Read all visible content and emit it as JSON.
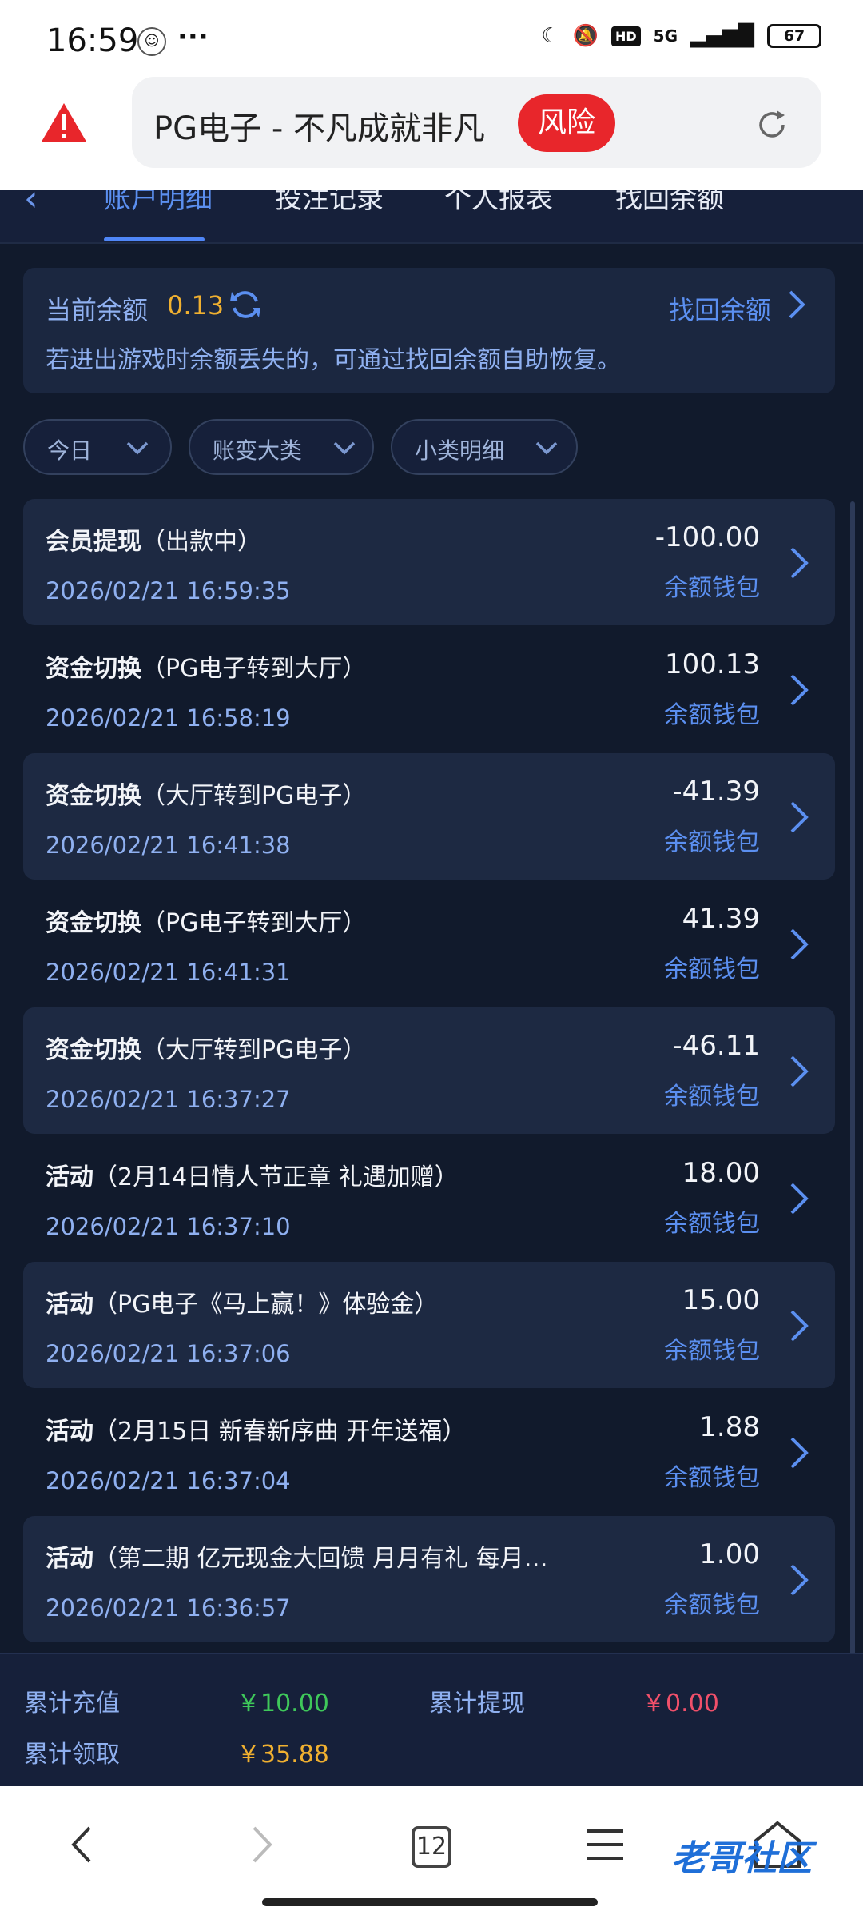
{
  "status_bar": {
    "time": "16:59",
    "dots": "···",
    "network": "5G",
    "hd": "HD",
    "battery": "67"
  },
  "address_bar": {
    "title": "PG电子 - 不凡成就非凡",
    "risk_label": "风险"
  },
  "tabs": [
    {
      "label": "账户明细",
      "active": true
    },
    {
      "label": "投注记录",
      "active": false
    },
    {
      "label": "个人报表",
      "active": false
    },
    {
      "label": "找回余额",
      "active": false
    }
  ],
  "balance": {
    "label": "当前余额",
    "value": "0.13",
    "recover_link": "找回余额",
    "note": "若进出游戏时余额丢失的，可通过找回余额自助恢复。"
  },
  "filters": [
    {
      "label": "今日"
    },
    {
      "label": "账变大类"
    },
    {
      "label": "小类明细"
    }
  ],
  "records": [
    {
      "type": "会员提现",
      "detail": "（出款中）",
      "time": "2026/02/21 16:59:35",
      "amount": "-100.00",
      "wallet": "余额钱包"
    },
    {
      "type": "资金切换",
      "detail": "（PG电子转到大厅）",
      "time": "2026/02/21 16:58:19",
      "amount": "100.13",
      "wallet": "余额钱包"
    },
    {
      "type": "资金切换",
      "detail": "（大厅转到PG电子）",
      "time": "2026/02/21 16:41:38",
      "amount": "-41.39",
      "wallet": "余额钱包"
    },
    {
      "type": "资金切换",
      "detail": "（PG电子转到大厅）",
      "time": "2026/02/21 16:41:31",
      "amount": "41.39",
      "wallet": "余额钱包"
    },
    {
      "type": "资金切换",
      "detail": "（大厅转到PG电子）",
      "time": "2026/02/21 16:37:27",
      "amount": "-46.11",
      "wallet": "余额钱包"
    },
    {
      "type": "活动",
      "detail": "（2月14日情人节正章 礼遇加赠）",
      "time": "2026/02/21 16:37:10",
      "amount": "18.00",
      "wallet": "余额钱包"
    },
    {
      "type": "活动",
      "detail": "（PG电子《马上赢！》体验金）",
      "time": "2026/02/21 16:37:06",
      "amount": "15.00",
      "wallet": "余额钱包"
    },
    {
      "type": "活动",
      "detail": "（2月15日 新春新序曲 开年送福）",
      "time": "2026/02/21 16:37:04",
      "amount": "1.88",
      "wallet": "余额钱包"
    },
    {
      "type": "活动",
      "detail": "（第二期 亿元现金大回馈 月月有礼 每月…",
      "time": "2026/02/21 16:36:57",
      "amount": "1.00",
      "wallet": "余额钱包"
    }
  ],
  "summary": {
    "deposit_label": "累计充值",
    "deposit_value": "￥10.00",
    "withdraw_label": "累计提现",
    "withdraw_value": "￥0.00",
    "claimed_label": "累计领取",
    "claimed_value": "￥35.88"
  },
  "nav": {
    "tab_count": "12",
    "watermark": "老哥社区"
  },
  "colors": {
    "bg": "#111a2c",
    "accent": "#5b8ff0",
    "amount_yellow": "#f0b030",
    "risk_red": "#e8262b",
    "green": "#3fc85a"
  }
}
